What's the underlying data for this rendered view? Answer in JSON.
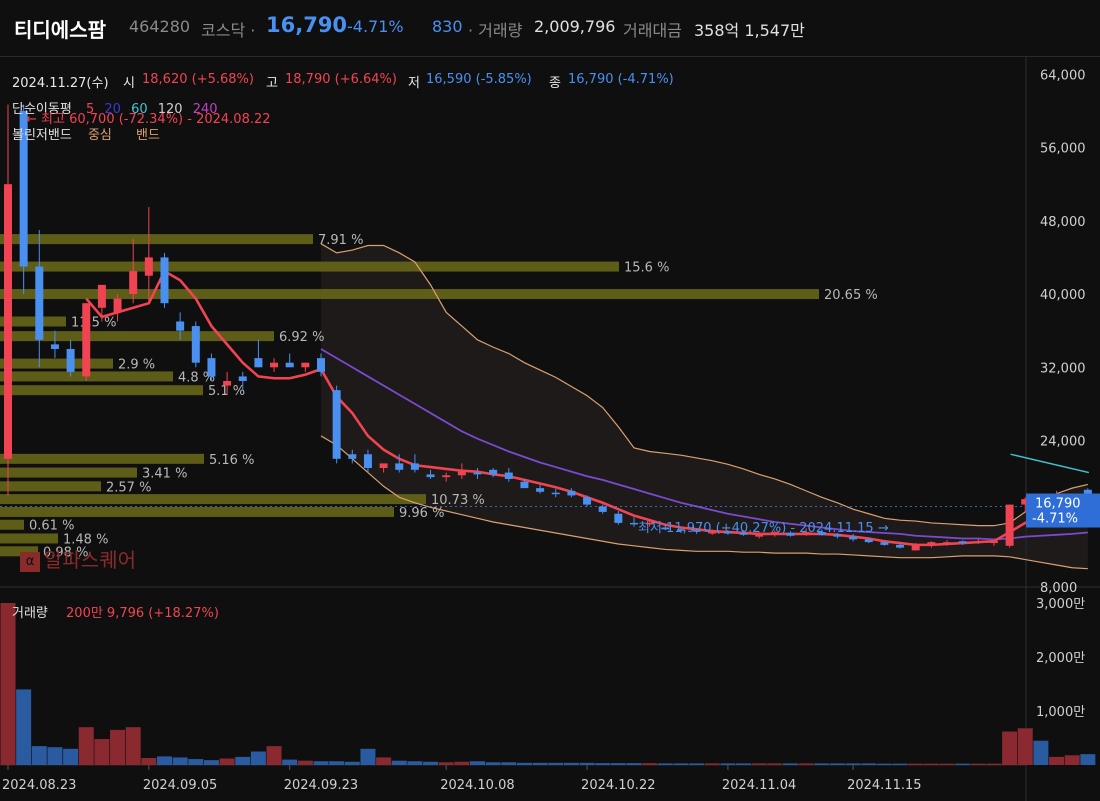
{
  "header": {
    "name": "티디에스팜",
    "code": "464280",
    "market": "코스닥 ·",
    "price": "16,790",
    "change_pct": "-4.71%",
    "change_abs": "830",
    "volume_label": "· 거래량",
    "volume": "2,009,796",
    "amount_label": "거래대금",
    "amount": "358억 1,547만"
  },
  "ohlc_bar": {
    "date": "2024.11.27(수)",
    "open_label": "시",
    "open": "18,620 (+5.68%)",
    "high_label": "고",
    "high": "18,790 (+6.64%)",
    "low_label": "저",
    "low": "16,590 (-5.85%)",
    "close_label": "종",
    "close": "16,790 (-4.71%)"
  },
  "indicators": {
    "ma_label": "단순이동평",
    "ma_periods": [
      "5",
      "20",
      "60",
      "120",
      "240"
    ],
    "ma_colors": [
      "#f04452",
      "#3a3ad0",
      "#3fc6d0",
      "#cfcfcf",
      "#c040c0"
    ],
    "bb_label": "볼린저밴드",
    "bb_mid": "중심",
    "bb_band": "밴드",
    "max_note": "최고 60,700 (-72.34%) - 2024.08.22",
    "min_note": "최저 11,970 (+40.27%) - 2024.11.15"
  },
  "watermark": "알파스퀘어",
  "price_axis": {
    "ticks": [
      "64,000",
      "56,000",
      "48,000",
      "40,000",
      "32,000",
      "24,000",
      "8,000"
    ],
    "current_price": "16,790",
    "current_pct": "-4.71%"
  },
  "volume_panel": {
    "label": "거래량",
    "ma_info": "200만 9,796 (+18.27%)",
    "ticks": [
      "3,000만",
      "2,000만",
      "1,000만"
    ]
  },
  "x_axis": {
    "ticks": [
      "2024.08.23",
      "2024.09.05",
      "2024.09.23",
      "2024.10.08",
      "2024.10.22",
      "2024.11.04",
      "2024.11.15"
    ]
  },
  "colors": {
    "up": "#f04452",
    "down": "#4a90f0",
    "ma5": "#f04452",
    "ma20": "#7a4ad0",
    "ma60": "#3fc6d0",
    "bb": "#d9a070",
    "profile": "#6b6b1a"
  },
  "chart_data": {
    "type": "candlestick",
    "title": "",
    "y_range": [
      8000,
      66000
    ],
    "volume_range": [
      0,
      3000
    ],
    "volume_unit": "만",
    "candles": [
      {
        "o": 22000,
        "h": 60700,
        "l": 18000,
        "c": 52000
      },
      {
        "o": 60000,
        "h": 60700,
        "l": 40000,
        "c": 43000
      },
      {
        "o": 43000,
        "h": 47000,
        "l": 32000,
        "c": 35000
      },
      {
        "o": 34500,
        "h": 36000,
        "l": 33000,
        "c": 34000
      },
      {
        "o": 34000,
        "h": 35000,
        "l": 31000,
        "c": 31500
      },
      {
        "o": 31000,
        "h": 39000,
        "l": 30500,
        "c": 39000
      },
      {
        "o": 38500,
        "h": 41000,
        "l": 37000,
        "c": 41000
      },
      {
        "o": 38000,
        "h": 40000,
        "l": 37000,
        "c": 39500
      },
      {
        "o": 40000,
        "h": 46000,
        "l": 39000,
        "c": 42500
      },
      {
        "o": 42000,
        "h": 49500,
        "l": 39000,
        "c": 44000
      },
      {
        "o": 44000,
        "h": 44500,
        "l": 38500,
        "c": 39000
      },
      {
        "o": 37000,
        "h": 38000,
        "l": 35000,
        "c": 36000
      },
      {
        "o": 36500,
        "h": 37000,
        "l": 32000,
        "c": 32500
      },
      {
        "o": 33000,
        "h": 33500,
        "l": 30500,
        "c": 31000
      },
      {
        "o": 30000,
        "h": 31500,
        "l": 29000,
        "c": 30500
      },
      {
        "o": 31000,
        "h": 31500,
        "l": 29500,
        "c": 30500
      },
      {
        "o": 33000,
        "h": 35000,
        "l": 32000,
        "c": 32000
      },
      {
        "o": 32000,
        "h": 33000,
        "l": 31500,
        "c": 32500
      },
      {
        "o": 32500,
        "h": 33500,
        "l": 32000,
        "c": 32000
      },
      {
        "o": 32000,
        "h": 32500,
        "l": 31500,
        "c": 32500
      },
      {
        "o": 33000,
        "h": 33500,
        "l": 31000,
        "c": 31500
      },
      {
        "o": 29500,
        "h": 30000,
        "l": 21500,
        "c": 22000
      },
      {
        "o": 22500,
        "h": 23000,
        "l": 21500,
        "c": 22000
      },
      {
        "o": 22500,
        "h": 23000,
        "l": 20500,
        "c": 21000
      },
      {
        "o": 21000,
        "h": 21500,
        "l": 20500,
        "c": 21500
      },
      {
        "o": 21500,
        "h": 22500,
        "l": 20500,
        "c": 20800
      },
      {
        "o": 21500,
        "h": 22500,
        "l": 20500,
        "c": 20800
      },
      {
        "o": 20300,
        "h": 20800,
        "l": 19800,
        "c": 20000
      },
      {
        "o": 20000,
        "h": 20500,
        "l": 19500,
        "c": 20200
      },
      {
        "o": 20200,
        "h": 21500,
        "l": 19800,
        "c": 20600
      },
      {
        "o": 20500,
        "h": 21000,
        "l": 19800,
        "c": 20300
      },
      {
        "o": 20800,
        "h": 21000,
        "l": 20000,
        "c": 20300
      },
      {
        "o": 20500,
        "h": 21000,
        "l": 19500,
        "c": 19800
      },
      {
        "o": 19500,
        "h": 19800,
        "l": 18800,
        "c": 18800
      },
      {
        "o": 18800,
        "h": 19200,
        "l": 18200,
        "c": 18400
      },
      {
        "o": 18300,
        "h": 18700,
        "l": 17800,
        "c": 18200
      },
      {
        "o": 18500,
        "h": 18800,
        "l": 17800,
        "c": 18000
      },
      {
        "o": 17800,
        "h": 18000,
        "l": 16800,
        "c": 17000
      },
      {
        "o": 16800,
        "h": 17000,
        "l": 16000,
        "c": 16200
      },
      {
        "o": 16000,
        "h": 16300,
        "l": 14800,
        "c": 15000
      },
      {
        "o": 15000,
        "h": 15600,
        "l": 14600,
        "c": 14900
      },
      {
        "o": 15000,
        "h": 15400,
        "l": 14600,
        "c": 15000
      },
      {
        "o": 14500,
        "h": 14900,
        "l": 14200,
        "c": 14300
      },
      {
        "o": 14300,
        "h": 14500,
        "l": 13900,
        "c": 14200
      },
      {
        "o": 14200,
        "h": 14400,
        "l": 13800,
        "c": 14100
      },
      {
        "o": 14000,
        "h": 14300,
        "l": 13700,
        "c": 14000
      },
      {
        "o": 14000,
        "h": 14200,
        "l": 13700,
        "c": 13900
      },
      {
        "o": 13900,
        "h": 14200,
        "l": 13600,
        "c": 13700
      },
      {
        "o": 13500,
        "h": 14000,
        "l": 13300,
        "c": 13700
      },
      {
        "o": 13700,
        "h": 14200,
        "l": 13500,
        "c": 14000
      },
      {
        "o": 13900,
        "h": 14100,
        "l": 13500,
        "c": 13600
      },
      {
        "o": 13800,
        "h": 14400,
        "l": 13600,
        "c": 14000
      },
      {
        "o": 14000,
        "h": 14300,
        "l": 13600,
        "c": 13700
      },
      {
        "o": 13700,
        "h": 13900,
        "l": 13300,
        "c": 13500
      },
      {
        "o": 13500,
        "h": 13800,
        "l": 13000,
        "c": 13200
      },
      {
        "o": 13200,
        "h": 13400,
        "l": 12800,
        "c": 12900
      },
      {
        "o": 12900,
        "h": 13100,
        "l": 12500,
        "c": 12600
      },
      {
        "o": 12600,
        "h": 12800,
        "l": 12200,
        "c": 12300
      },
      {
        "o": 12000,
        "h": 12800,
        "l": 11970,
        "c": 12700
      },
      {
        "o": 12600,
        "h": 13000,
        "l": 12300,
        "c": 12900
      },
      {
        "o": 12800,
        "h": 13100,
        "l": 12500,
        "c": 12900
      },
      {
        "o": 13000,
        "h": 13100,
        "l": 12600,
        "c": 12800
      },
      {
        "o": 12900,
        "h": 13300,
        "l": 12700,
        "c": 13000
      },
      {
        "o": 12800,
        "h": 13100,
        "l": 12500,
        "c": 13000
      },
      {
        "o": 12500,
        "h": 17000,
        "l": 12300,
        "c": 17000
      },
      {
        "o": 17000,
        "h": 17800,
        "l": 16200,
        "c": 17600
      },
      {
        "o": 17600,
        "h": 17800,
        "l": 17100,
        "c": 17400
      },
      {
        "o": 17300,
        "h": 18500,
        "l": 16900,
        "c": 17500
      },
      {
        "o": 17500,
        "h": 18100,
        "l": 17200,
        "c": 17600
      },
      {
        "o": 18620,
        "h": 18790,
        "l": 16590,
        "c": 16790
      }
    ],
    "volumes": [
      3000,
      1400,
      350,
      330,
      300,
      700,
      480,
      650,
      700,
      130,
      160,
      140,
      110,
      90,
      120,
      150,
      250,
      350,
      100,
      80,
      70,
      70,
      60,
      300,
      140,
      80,
      70,
      60,
      50,
      60,
      70,
      50,
      50,
      40,
      40,
      40,
      40,
      40,
      35,
      35,
      35,
      35,
      30,
      30,
      30,
      30,
      30,
      30,
      30,
      30,
      30,
      30,
      30,
      30,
      30,
      30,
      25,
      25,
      25,
      25,
      25,
      25,
      25,
      25,
      620,
      680,
      450,
      150,
      180,
      201
    ],
    "ma5": [
      null,
      null,
      null,
      null,
      null,
      39500,
      37500,
      38000,
      38500,
      39000,
      42500,
      41500,
      39500,
      36500,
      34500,
      32500,
      31000,
      30800,
      30800,
      31200,
      31800,
      28800,
      27000,
      24500,
      23000,
      22000,
      21300,
      21100,
      20900,
      20700,
      20600,
      20300,
      20100,
      19700,
      19300,
      18900,
      18400,
      17800,
      17200,
      16500,
      15800,
      15300,
      14800,
      14500,
      14300,
      14100,
      14000,
      13900,
      13800,
      13800,
      13800,
      13800,
      13800,
      13700,
      13500,
      13300,
      13000,
      12800,
      12600,
      12600,
      12700,
      12800,
      12900,
      13000,
      14000,
      15000,
      15800,
      16300,
      16800,
      16950
    ],
    "ma20": [
      null,
      null,
      null,
      null,
      null,
      null,
      null,
      null,
      null,
      null,
      null,
      null,
      null,
      null,
      null,
      null,
      null,
      null,
      null,
      null,
      34000,
      33000,
      32000,
      31000,
      30000,
      29000,
      28000,
      27000,
      26000,
      25000,
      24200,
      23500,
      22800,
      22200,
      21600,
      21100,
      20600,
      20100,
      19700,
      19200,
      18700,
      18200,
      17700,
      17200,
      16800,
      16400,
      16000,
      15700,
      15400,
      15100,
      14900,
      14700,
      14500,
      14300,
      14100,
      14000,
      13900,
      13800,
      13600,
      13500,
      13400,
      13300,
      13300,
      13200,
      13300,
      13500,
      13600,
      13700,
      13800,
      13950
    ],
    "ma60_points": [
      [
        64,
        22500
      ],
      [
        69,
        20500
      ]
    ],
    "bb_upper": [
      null,
      null,
      null,
      null,
      null,
      null,
      null,
      null,
      null,
      null,
      null,
      null,
      null,
      null,
      null,
      null,
      null,
      null,
      null,
      null,
      45500,
      44500,
      44800,
      45300,
      45300,
      44500,
      43500,
      41000,
      38000,
      36500,
      35000,
      34200,
      33500,
      32500,
      31700,
      30900,
      29900,
      28900,
      27600,
      25500,
      23200,
      22800,
      22600,
      22400,
      22100,
      21800,
      21400,
      20900,
      20300,
      19800,
      19200,
      18500,
      17800,
      17200,
      16500,
      16000,
      15500,
      15300,
      15200,
      15000,
      14900,
      14800,
      14700,
      14700,
      15000,
      16200,
      17300,
      18200,
      18800,
      19200
    ],
    "bb_lower": [
      null,
      null,
      null,
      null,
      null,
      null,
      null,
      null,
      null,
      null,
      null,
      null,
      null,
      null,
      null,
      null,
      null,
      null,
      null,
      null,
      24500,
      23500,
      22000,
      20500,
      19000,
      17800,
      17200,
      16700,
      16300,
      15900,
      15500,
      15100,
      14800,
      14500,
      14200,
      13900,
      13600,
      13300,
      13000,
      12700,
      12500,
      12300,
      12100,
      12000,
      11900,
      11900,
      11900,
      11800,
      11800,
      11700,
      11700,
      11700,
      11600,
      11600,
      11500,
      11400,
      11300,
      11200,
      11200,
      11200,
      11300,
      11400,
      11400,
      11400,
      11300,
      11000,
      10700,
      10400,
      10100,
      10000
    ],
    "volume_profile": [
      {
        "price": 46000,
        "pct": "7.91 %",
        "len": 313
      },
      {
        "price": 43000,
        "pct": "15.6 %",
        "len": 619
      },
      {
        "price": 40000,
        "pct": "20.65 %",
        "len": 819
      },
      {
        "price": 37000,
        "pct": "11.5 %",
        "len": 66
      },
      {
        "price": 35400,
        "pct": "6.92 %",
        "len": 274
      },
      {
        "price": 32400,
        "pct": "2.9 %",
        "len": 113
      },
      {
        "price": 31000,
        "pct": "4.8 %",
        "len": 173
      },
      {
        "price": 29500,
        "pct": "5.1 %",
        "len": 203
      },
      {
        "price": 22000,
        "pct": "5.16 %",
        "len": 204
      },
      {
        "price": 20500,
        "pct": "3.41 %",
        "len": 137
      },
      {
        "price": 19000,
        "pct": "2.57 %",
        "len": 101
      },
      {
        "price": 17600,
        "pct": "10.73 %",
        "len": 426
      },
      {
        "price": 16200,
        "pct": "9.96 %",
        "len": 394
      },
      {
        "price": 14800,
        "pct": "0.61 %",
        "len": 24
      },
      {
        "price": 13300,
        "pct": "1.48 %",
        "len": 58
      },
      {
        "price": 11900,
        "pct": "0.98 %",
        "len": 38
      }
    ],
    "x_tick_dates": [
      "2024.08.23",
      "2024.09.05",
      "2024.09.23",
      "2024.10.08",
      "2024.10.22",
      "2024.11.04",
      "2024.11.15"
    ]
  }
}
